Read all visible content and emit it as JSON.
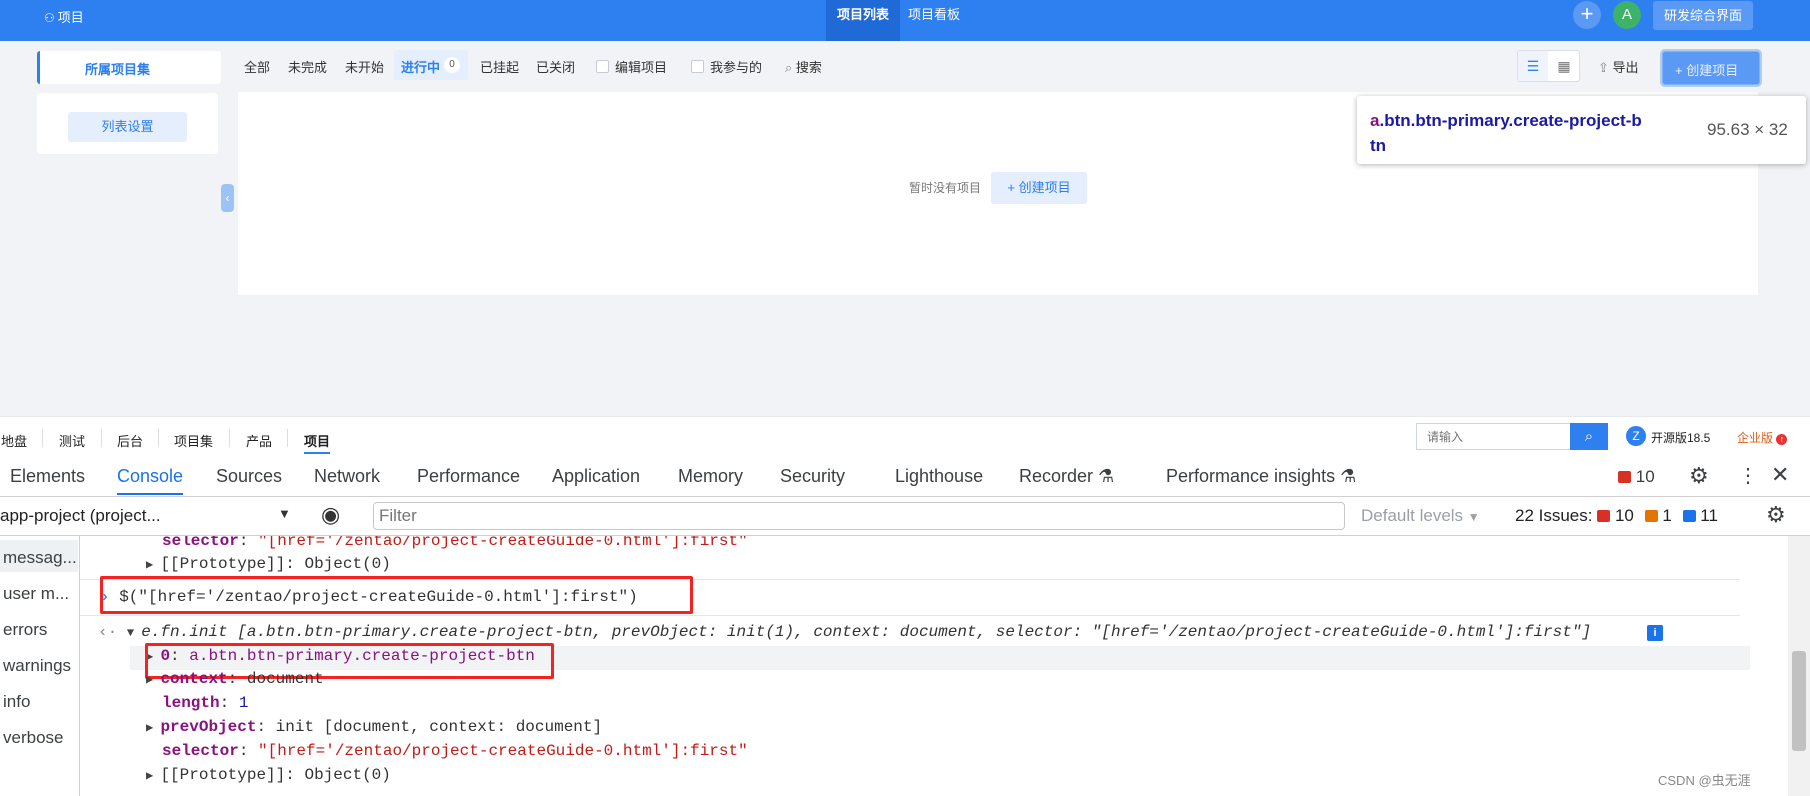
{
  "topbar": {
    "brand": "项目",
    "tabs": [
      "项目列表",
      "项目看板"
    ],
    "avatar_letter": "A",
    "workspace_button": "研发综合界面"
  },
  "left_panel": {
    "project_set": "所属项目集",
    "list_settings": "列表设置"
  },
  "filters": {
    "all": "全部",
    "unfinished": "未完成",
    "not_started": "未开始",
    "in_progress": "进行中",
    "in_progress_count": "0",
    "suspended": "已挂起",
    "closed": "已关闭",
    "edit_projects": "编辑项目",
    "my_involved": "我参与的",
    "search": "搜索"
  },
  "actions": {
    "export": "导出",
    "create_project": "创建项目"
  },
  "empty_state": {
    "text": "暂时没有项目",
    "create_button": "创建项目"
  },
  "inspect_tooltip": {
    "tag": "a",
    "selector_line1": ".btn.btn-primary.create-project-b",
    "selector_line2": "tn",
    "size": "95.63 × 32"
  },
  "appbar": {
    "items": [
      "地盘",
      "测试",
      "后台",
      "项目集",
      "产品",
      "项目"
    ],
    "search_placeholder": "请输入",
    "version": "开源版18.5",
    "enterprise": "企业版"
  },
  "devtools": {
    "tabs": [
      "Elements",
      "Console",
      "Sources",
      "Network",
      "Performance",
      "Application",
      "Memory",
      "Security",
      "Lighthouse",
      "Recorder",
      "Performance insights"
    ],
    "error_count": "10",
    "context": "app-project (project...",
    "filter_placeholder": "Filter",
    "levels": "Default levels",
    "issues_label": "22 Issues:",
    "issues_errors": "10",
    "issues_warnings": "1",
    "issues_info": "11",
    "sidebar": [
      "messag...",
      "user m...",
      "errors",
      "warnings",
      "info",
      "verbose"
    ],
    "console": {
      "top_selector_key": "selector",
      "top_selector_val": "\"[href='/zentao/project-createGuide-0.html']:first\"",
      "proto1": "[[Prototype]]",
      "proto1_val": "Object(0)",
      "input": "$(\"[href='/zentao/project-createGuide-0.html']:first\")",
      "result_head": "e.fn.init [a.btn.btn-primary.create-project-btn, prevObject: init(1), context: document, selector: \"[href='/zentao/project-createGuide-0.html']:first\"]",
      "item0_key": "0",
      "item0_val": "a.btn.btn-primary.create-project-btn",
      "context_key": "context",
      "context_val": "document",
      "length_key": "length",
      "length_val": "1",
      "prev_key": "prevObject",
      "prev_val": "init [document, context: document]",
      "selector_key": "selector",
      "selector_val": "\"[href='/zentao/project-createGuide-0.html']:first\"",
      "proto2": "[[Prototype]]",
      "proto2_val": "Object(0)"
    }
  },
  "watermark": "CSDN @虫无涯"
}
